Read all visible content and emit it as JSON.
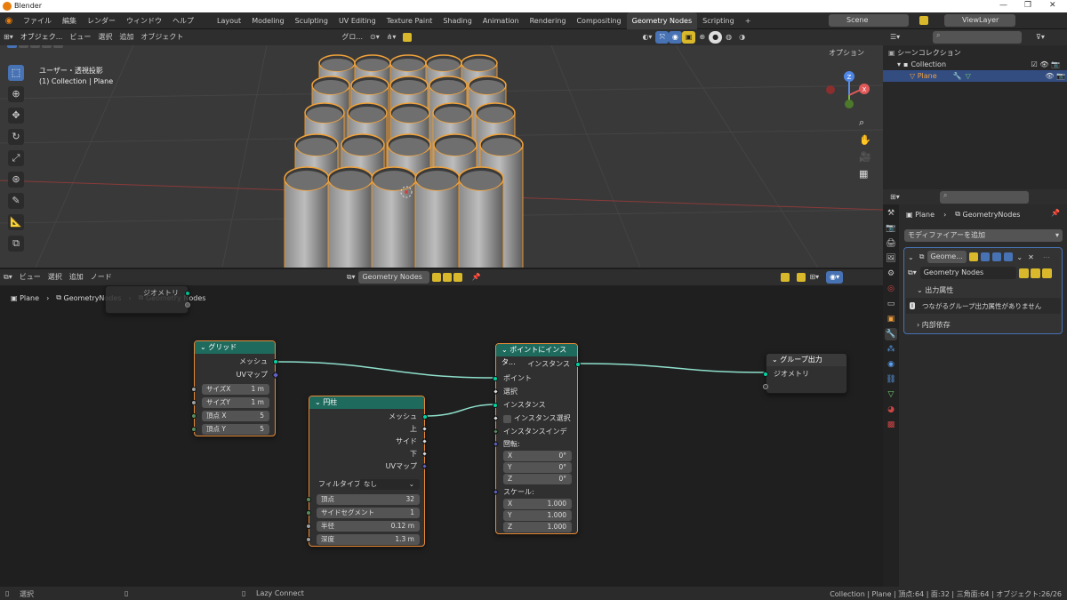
{
  "app": {
    "title": "Blender",
    "window_controls": [
      "—",
      "❐",
      "✕"
    ]
  },
  "menu": [
    "ファイル",
    "編集",
    "レンダー",
    "ウィンドウ",
    "ヘルプ"
  ],
  "workspaces": [
    "Layout",
    "Modeling",
    "Sculpting",
    "UV Editing",
    "Texture Paint",
    "Shading",
    "Animation",
    "Rendering",
    "Compositing",
    "Geometry Nodes",
    "Scripting"
  ],
  "active_workspace": "Geometry Nodes",
  "add_tab": "+",
  "scene": {
    "name": "Scene",
    "viewlayer": "ViewLayer"
  },
  "viewport": {
    "menus": [
      "オブジェク...",
      "ビュー",
      "選択",
      "追加",
      "オブジェクト"
    ],
    "transform": "グロ...",
    "overlay_title": "ユーザー・透視投影",
    "overlay_sub": "(1) Collection | Plane",
    "options": "オプション",
    "axes": {
      "x": "X",
      "y": "Y",
      "z": "Z"
    }
  },
  "outliner": {
    "root": "シーンコレクション",
    "collection": "Collection",
    "object": "Plane"
  },
  "properties": {
    "breadcrumb_obj": "Plane",
    "breadcrumb_mod": "GeometryNodes",
    "add_modifier": "モディファイアーを追加",
    "modifier_name": "Geome...",
    "node_group": "Geometry Nodes",
    "output_attr": "出力属性",
    "info": "つながるグループ出力属性がありません",
    "internal_deps": "内部依存"
  },
  "node_editor": {
    "menus": [
      "ビュー",
      "選択",
      "追加",
      "ノード"
    ],
    "group": "Geometry Nodes",
    "breadcrumb": [
      "Plane",
      "GeometryNodes",
      "Geometry Nodes"
    ],
    "group_input_label": "ジオメトリ"
  },
  "nodes": {
    "grid": {
      "title": "グリッド",
      "out": [
        "メッシュ",
        "UVマップ"
      ],
      "fields": [
        {
          "label": "サイズX",
          "value": "1 m"
        },
        {
          "label": "サイズY",
          "value": "1 m"
        },
        {
          "label": "頂点 X",
          "value": "5"
        },
        {
          "label": "頂点 Y",
          "value": "5"
        }
      ]
    },
    "cylinder": {
      "title": "円柱",
      "out": [
        "メッシュ",
        "上",
        "サイド",
        "下",
        "UVマップ"
      ],
      "fill_label": "フィルタイプ",
      "fill_value": "なし",
      "fields": [
        {
          "label": "頂点",
          "value": "32"
        },
        {
          "label": "サイドセグメント",
          "value": "1"
        },
        {
          "label": "半径",
          "value": "0.12 m"
        },
        {
          "label": "深度",
          "value": "1.3 m"
        }
      ]
    },
    "instance": {
      "title": "ポイントにインスタ...",
      "out": "インスタンス",
      "inputs": [
        "ポイント",
        "選択",
        "インスタンス",
        "インスタンス選択",
        "インスタンスインデッ..."
      ],
      "rot_label": "回転:",
      "rot": [
        {
          "label": "X",
          "value": "0°"
        },
        {
          "label": "Y",
          "value": "0°"
        },
        {
          "label": "Z",
          "value": "0°"
        }
      ],
      "scale_label": "スケール:",
      "scale": [
        {
          "label": "X",
          "value": "1.000"
        },
        {
          "label": "Y",
          "value": "1.000"
        },
        {
          "label": "Z",
          "value": "1.000"
        }
      ]
    },
    "group_output": {
      "title": "グループ出力",
      "input": "ジオメトリ"
    }
  },
  "status": {
    "left": "選択",
    "mid": "Lazy Connect",
    "right": "Collection | Plane | 頂点:64 | 面:32 | 三角面:64 | オブジェクト:26/26"
  },
  "colors": {
    "accent": "#4772b3",
    "geometry_socket": "#00d6a3",
    "selected": "#e88a36",
    "node_header": "#1e6b5e"
  }
}
